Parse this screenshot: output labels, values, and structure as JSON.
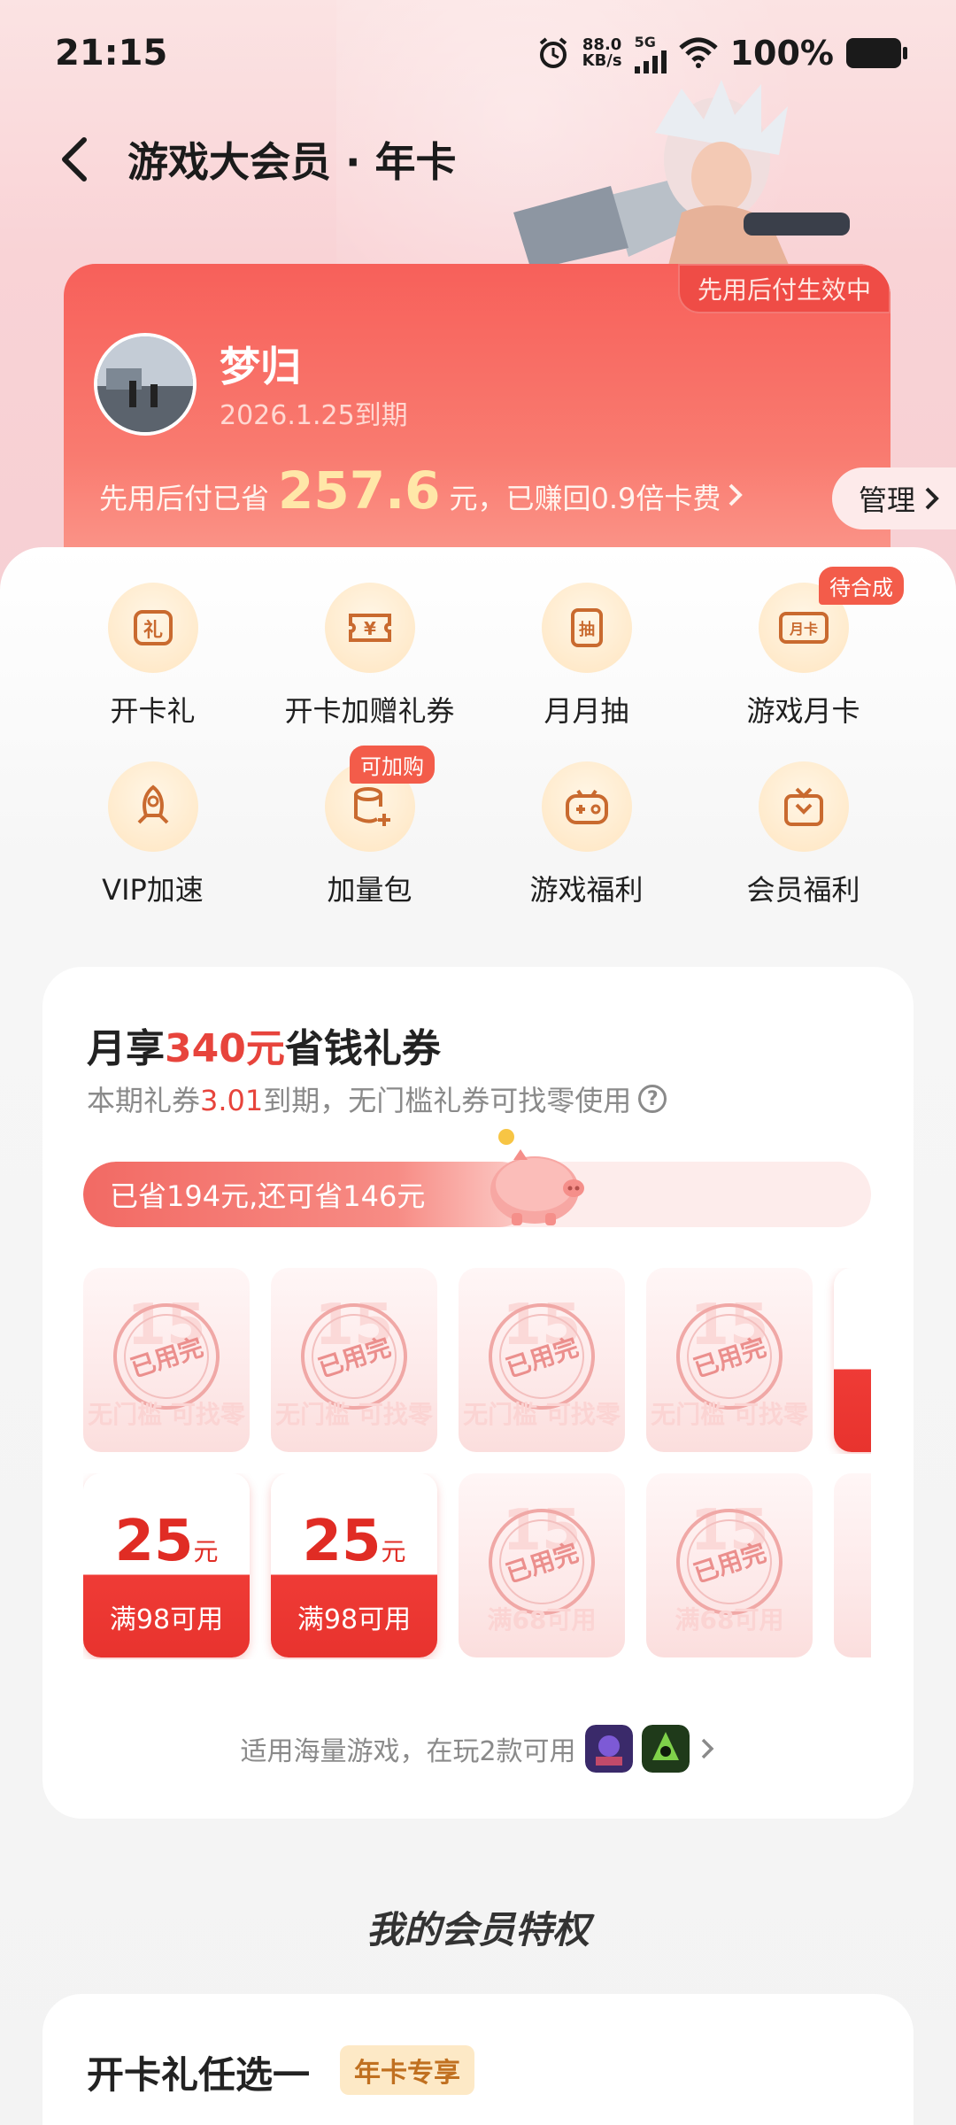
{
  "status_bar": {
    "time": "21:15",
    "net_speed": "88.0",
    "net_unit": "KB/s",
    "network": "5G",
    "battery": "100%"
  },
  "header": {
    "title": "游戏大会员 · 年卡"
  },
  "member_card": {
    "badge": "先用后付生效中",
    "user_name": "梦归",
    "expire": "2026.1.25到期",
    "saved_prefix": "先用后付已省",
    "saved_amount": "257.6",
    "saved_suffix": "元，已赚回0.9倍卡费",
    "manage": "管理"
  },
  "benefits": [
    {
      "label": "开卡礼",
      "icon": "gift-icon",
      "glyph": "礼"
    },
    {
      "label": "开卡加赠礼券",
      "icon": "coupon-icon",
      "glyph": "¥"
    },
    {
      "label": "月月抽",
      "icon": "lottery-icon",
      "glyph": "抽"
    },
    {
      "label": "游戏月卡",
      "icon": "month-card-icon",
      "glyph": "月卡",
      "tag": "待合成"
    },
    {
      "label": "VIP加速",
      "icon": "rocket-icon",
      "glyph": ""
    },
    {
      "label": "加量包",
      "icon": "package-icon",
      "glyph": "",
      "tag": "可加购"
    },
    {
      "label": "游戏福利",
      "icon": "gamepad-icon",
      "glyph": ""
    },
    {
      "label": "会员福利",
      "icon": "member-gift-icon",
      "glyph": ""
    }
  ],
  "coupons": {
    "title_prefix": "月享",
    "title_amount": "340元",
    "title_suffix": "省钱礼券",
    "sub_prefix": "本期礼券",
    "sub_date": "3.01",
    "sub_suffix": "到期，无门槛礼券可找零使用",
    "help": "?",
    "progress_text": "已省194元,还可省146元",
    "progress_fraction": 0.57,
    "row1": [
      {
        "ghost": "15",
        "stamp": "已用完",
        "cond": "无门槛 可找零"
      },
      {
        "ghost": "15",
        "stamp": "已用完",
        "cond": "无门槛 可找零"
      },
      {
        "ghost": "15",
        "stamp": "已用完",
        "cond": "无门槛 可找零"
      },
      {
        "ghost": "15",
        "stamp": "已用完",
        "cond": "无门槛 可找零"
      }
    ],
    "row2": [
      {
        "amount": "25",
        "unit": "元",
        "cond": "满98可用"
      },
      {
        "amount": "25",
        "unit": "元",
        "cond": "满98可用"
      },
      {
        "ghost": "15",
        "stamp": "已用完",
        "cond": "满68可用"
      },
      {
        "ghost": "15",
        "stamp": "已用完",
        "cond": "满68可用"
      }
    ],
    "apply_text": "适用海量游戏，在玩2款可用"
  },
  "privileges": {
    "section_title": "我的会员特权",
    "card_title": "开卡礼任选一",
    "card_tag": "年卡专享"
  }
}
